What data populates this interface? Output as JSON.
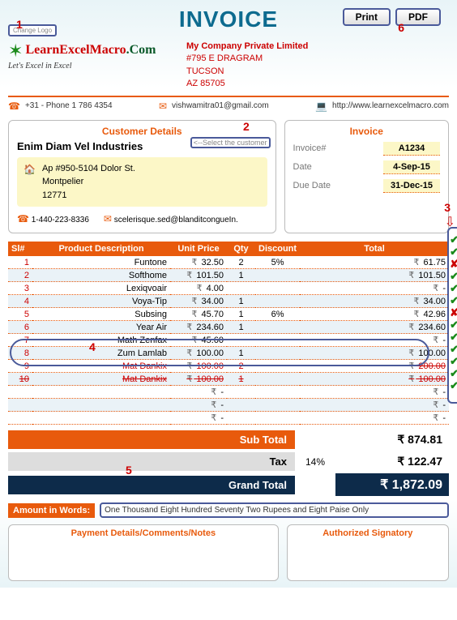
{
  "title": "INVOICE",
  "buttons": {
    "print": "Print",
    "pdf": "PDF",
    "change_logo": "Change Logo",
    "select_customer": "<--Select the customer"
  },
  "annotations": {
    "n1": "1",
    "n2": "2",
    "n3": "3",
    "n4": "4",
    "n5": "5",
    "n6": "6"
  },
  "logo": {
    "brand1": "LearnExcelMacro",
    "brand2": ".Com",
    "tagline": "Let's Excel in Excel"
  },
  "company": {
    "name": "My Company Private Limited",
    "addr1": "#795 E DRAGRAM",
    "addr2": "TUCSON",
    "addr3": "AZ 85705"
  },
  "contact": {
    "phone": "+31 - Phone 1 786 4354",
    "email": "vishwamitra01@gmail.com",
    "web": "http://www.learnexcelmacro.com"
  },
  "cust": {
    "title": "Customer Details",
    "name": "Enim Diam Vel Industries",
    "addr1": "Ap #950-5104 Dolor St.",
    "addr2": "Montpelier",
    "addr3": "12771",
    "phone": "1-440-223-8336",
    "email": "scelerisque.sed@blanditcongueIn."
  },
  "invoice": {
    "title": "Invoice",
    "num_lbl": "Invoice#",
    "num": "A1234",
    "date_lbl": "Date",
    "date": "4-Sep-15",
    "due_lbl": "Due Date",
    "due": "31-Dec-15"
  },
  "cols": {
    "sl": "Sl#",
    "desc": "Product Description",
    "price": "Unit Price",
    "qty": "Qty",
    "disc": "Discount",
    "total": "Total"
  },
  "cur": "₹",
  "rows": [
    {
      "sl": "1",
      "desc": "Funtone",
      "price": "32.50",
      "qty": "2",
      "disc": "5%",
      "total": "61.75",
      "strike": false
    },
    {
      "sl": "2",
      "desc": "Softhome",
      "price": "101.50",
      "qty": "1",
      "disc": "",
      "total": "101.50",
      "strike": false
    },
    {
      "sl": "3",
      "desc": "Lexiqvoair",
      "price": "4.00",
      "qty": "",
      "disc": "",
      "total": "-",
      "strike": false
    },
    {
      "sl": "4",
      "desc": "Voya-Tip",
      "price": "34.00",
      "qty": "1",
      "disc": "",
      "total": "34.00",
      "strike": false
    },
    {
      "sl": "5",
      "desc": "Subsing",
      "price": "45.70",
      "qty": "1",
      "disc": "6%",
      "total": "42.96",
      "strike": false
    },
    {
      "sl": "6",
      "desc": "Year Air",
      "price": "234.60",
      "qty": "1",
      "disc": "",
      "total": "234.60",
      "strike": false
    },
    {
      "sl": "7",
      "desc": "Math Zenfax",
      "price": "45.60",
      "qty": "",
      "disc": "",
      "total": "-",
      "strike": false
    },
    {
      "sl": "8",
      "desc": "Zum Lamlab",
      "price": "100.00",
      "qty": "1",
      "disc": "",
      "total": "100.00",
      "strike": false
    },
    {
      "sl": "9",
      "desc": "Mat Dankix",
      "price": "100.00",
      "qty": "2",
      "disc": "",
      "total": "200.00",
      "strike": true
    },
    {
      "sl": "10",
      "desc": "Mat Dankix",
      "price": "100.00",
      "qty": "1",
      "disc": "",
      "total": "100.00",
      "strike": true
    },
    {
      "sl": "",
      "desc": "",
      "price": "-",
      "qty": "",
      "disc": "",
      "total": "-",
      "strike": false
    },
    {
      "sl": "",
      "desc": "",
      "price": "-",
      "qty": "",
      "disc": "",
      "total": "-",
      "strike": false
    },
    {
      "sl": "",
      "desc": "",
      "price": "-",
      "qty": "",
      "disc": "",
      "total": "-",
      "strike": false
    }
  ],
  "totals": {
    "sub_lbl": "Sub Total",
    "sub": "874.81",
    "tax_lbl": "Tax",
    "tax_pct": "14%",
    "tax": "122.47",
    "gt_lbl": "Grand Total",
    "gt": "1,872.09"
  },
  "words": {
    "lbl": "Amount in Words:",
    "val": "One Thousand Eight Hundred Seventy Two Rupees and Eight Paise Only"
  },
  "bottom": {
    "notes": "Payment Details/Comments/Notes",
    "sign": "Authorized Signatory"
  },
  "checks": [
    "✔",
    "✔",
    "✘",
    "✔",
    "✔",
    "✔",
    "✘",
    "✔",
    "✔",
    "✔",
    "✔",
    "✔",
    "✔"
  ]
}
